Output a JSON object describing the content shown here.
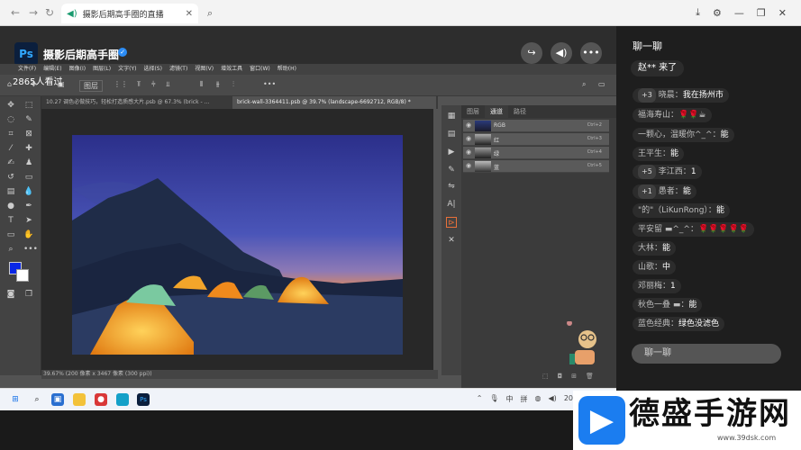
{
  "browser": {
    "tab_title": "摄影后期高手圈的直播",
    "close_glyph": "✕"
  },
  "stream": {
    "title": "摄影后期高手圈",
    "viewers": "2865人看过",
    "logo_text": "Ps"
  },
  "photoshop": {
    "menu": [
      "文件(F)",
      "编辑(E)",
      "图像(I)",
      "图层(L)",
      "文字(Y)",
      "选择(S)",
      "滤镜(T)",
      "视图(V)",
      "增效工具",
      "窗口(W)",
      "帮助(H)"
    ],
    "options_label": "图层",
    "doc_tabs": [
      "10.27 调色必做技巧，轻松打造质感大片.psb @ 67.3% (brick - ...",
      "brick-wall-3364411.psb @ 39.7% (landscape-6692712, RGB/8) *"
    ],
    "status": "39.67%   (200 像素 x 3467 像素 (300 ppi))",
    "panel_tabs": [
      "图层",
      "通道",
      "路径"
    ],
    "channels": [
      {
        "name": "RGB",
        "key": "Ctrl+2"
      },
      {
        "name": "红",
        "key": "Ctrl+3"
      },
      {
        "name": "绿",
        "key": "Ctrl+4"
      },
      {
        "name": "蓝",
        "key": "Ctrl+5"
      }
    ]
  },
  "chat": {
    "title": "聊一聊",
    "notice": "赵** 来了",
    "messages": [
      {
        "badge": "+3",
        "nick": "晓晨：",
        "text": "我在扬州市"
      },
      {
        "badge": "",
        "nick": "福海寿山：",
        "text": "🌹🌹☕"
      },
      {
        "badge": "",
        "nick": "一颗心，温暖你^_^：",
        "text": "能"
      },
      {
        "badge": "",
        "nick": "王平生：",
        "text": "能"
      },
      {
        "badge": "+5",
        "nick": "李江西：",
        "text": "1"
      },
      {
        "badge": "+1",
        "nick": "愚者：",
        "text": "能"
      },
      {
        "badge": "",
        "nick": "\"的\"（LiKunRong）：",
        "text": "能"
      },
      {
        "badge": "",
        "nick": "平安留 ▬^_^：",
        "text": "🌹🌹🌹🌹🌹"
      },
      {
        "badge": "",
        "nick": "大林：",
        "text": "能"
      },
      {
        "badge": "",
        "nick": "山歌：",
        "text": "中"
      },
      {
        "badge": "",
        "nick": "邓丽梅：",
        "text": "1"
      },
      {
        "badge": "",
        "nick": "秋色一叠 ▬：",
        "text": "能"
      },
      {
        "badge": "",
        "nick": "蓝色经典：",
        "text": "绿色没滤色"
      }
    ],
    "input_placeholder": "聊一聊"
  },
  "taskbar": {
    "tray": [
      "中",
      "拼"
    ],
    "time": "20"
  },
  "watermark": {
    "text": "德盛手游网",
    "url": "www.39dsk.com"
  }
}
